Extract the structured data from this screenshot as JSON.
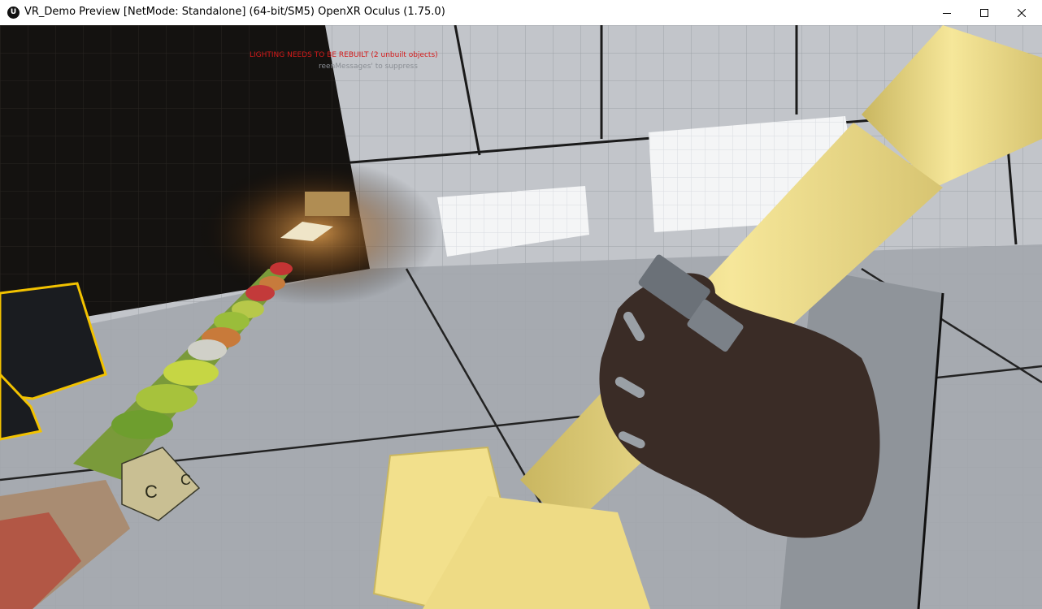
{
  "window": {
    "icon": "unreal-logo-icon",
    "title": "VR_Demo Preview [NetMode: Standalone]  (64-bit/SM5) OpenXR Oculus (1.75.0)",
    "controls": [
      "minimize-icon",
      "maximize-icon",
      "close-icon"
    ]
  },
  "viewport": {
    "messages": {
      "warning": "LIGHTING NEEDS TO BE REBUILT (2 unbuilt objects)",
      "hint": "reenMessages' to suppress"
    },
    "blocks": {
      "letter": "C"
    }
  },
  "colors": {
    "warning_text": "#d41a1a",
    "hint_text": "#8a8e94",
    "selection_outline": "#f2c200",
    "held_object": "#f2e08c"
  }
}
